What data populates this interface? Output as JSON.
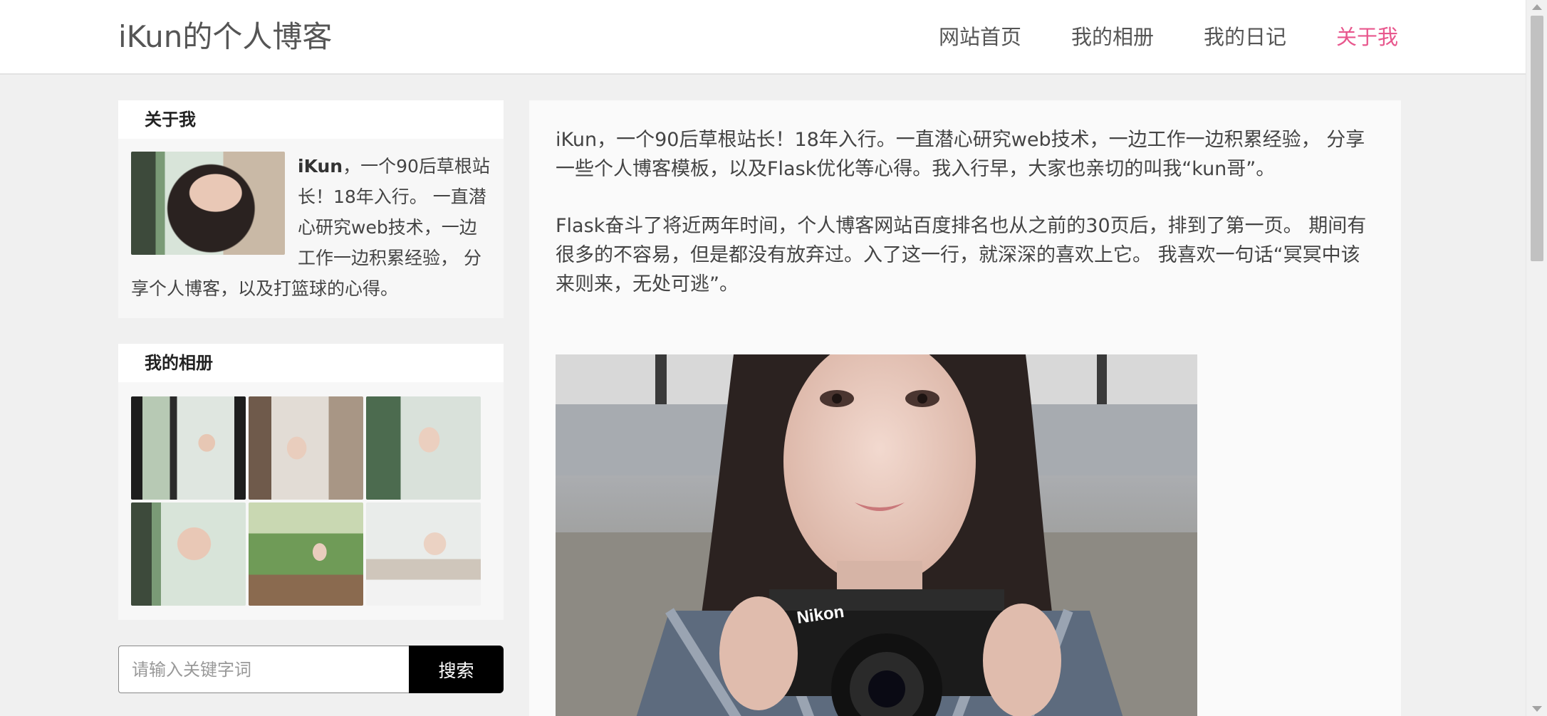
{
  "header": {
    "site_title": "iKun的个人博客",
    "nav": [
      {
        "label": "网站首页"
      },
      {
        "label": "我的相册"
      },
      {
        "label": "我的日记"
      },
      {
        "label": "关于我"
      }
    ]
  },
  "sidebar": {
    "about": {
      "title": "关于我",
      "name": "iKun",
      "text": "，一个90后草根站长！18年入行。 一直潜心研究web技术，一边工作一边积累经验， 分享个人博客，以及打篮球的心得。"
    },
    "album": {
      "title": "我的相册"
    },
    "search": {
      "placeholder": "请输入关键字词",
      "button_label": "搜索"
    }
  },
  "main": {
    "paragraphs": [
      "iKun，一个90后草根站长！18年入行。一直潜心研究web技术，一边工作一边积累经验， 分享一些个人博客模板，以及Flask优化等心得。我入行早，大家也亲切的叫我“kun哥”。",
      "Flask奋斗了将近两年时间，个人博客网站百度排名也从之前的30页后，排到了第一页。 期间有很多的不容易，但是都没有放弃过。入了这一行，就深深的喜欢上它。 我喜欢一句话“冥冥中该来则来，无处可逃”。"
    ],
    "camera_brand": "Nikon"
  },
  "colors": {
    "accent": "#e8578d",
    "search_button": "#000000",
    "background": "#f0f0f0"
  }
}
